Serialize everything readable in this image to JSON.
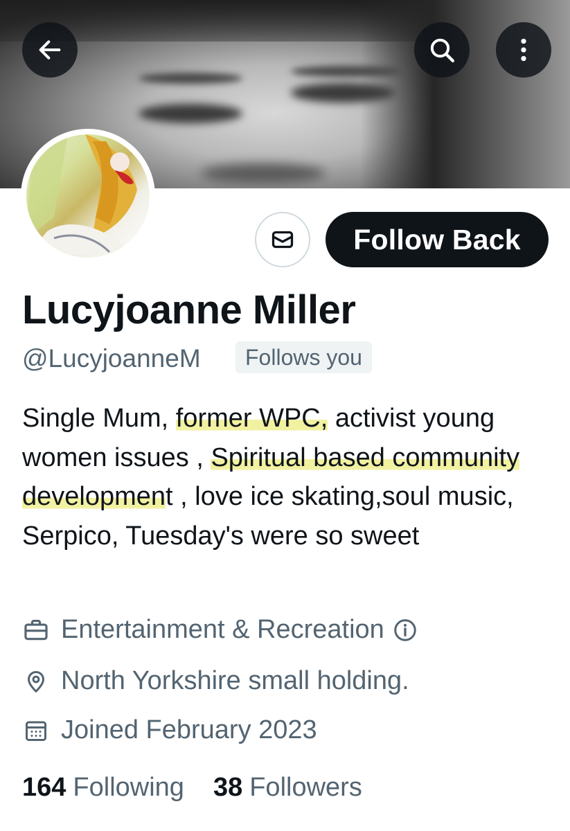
{
  "header": {
    "back_icon": "arrow-left-icon",
    "search_icon": "search-icon",
    "more_icon": "more-vertical-icon"
  },
  "profile": {
    "display_name": "Lucyjoanne Miller",
    "handle": "@LucyjoanneM",
    "follows_you": "Follows you",
    "follow_button": "Follow Back",
    "message_icon": "envelope-icon",
    "bio": {
      "p1": "Single  Mum, ",
      "hl1": "former WPC,",
      "p2": " activist young women issues , ",
      "hl2": "Spiritual based community developmen",
      "p3": "t , love ice skating,soul music, Serpico,  Tuesday's were so sweet"
    },
    "highlight_color": "#ecec82"
  },
  "meta": {
    "category": "Entertainment & Recreation",
    "location": "North Yorkshire small holding.",
    "joined": "Joined February 2023"
  },
  "stats": {
    "following_count": "164",
    "following_label": "Following",
    "followers_count": "38",
    "followers_label": "Followers"
  }
}
